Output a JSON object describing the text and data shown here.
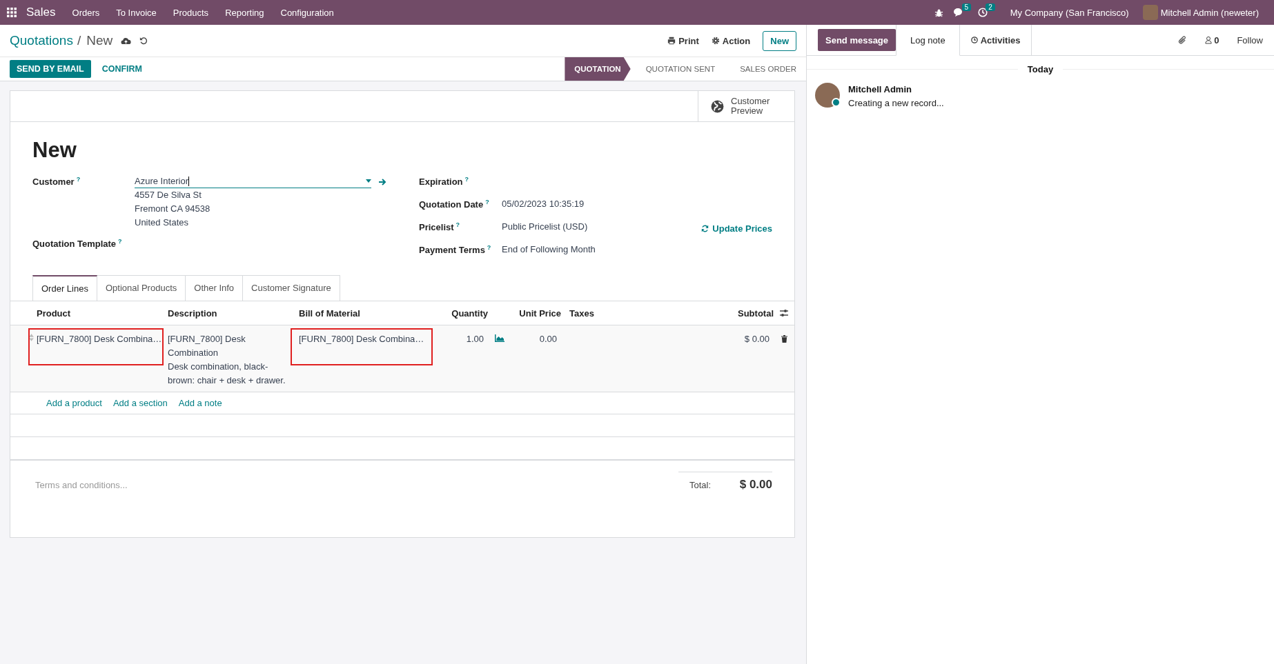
{
  "navbar": {
    "app": "Sales",
    "menu": [
      "Orders",
      "To Invoice",
      "Products",
      "Reporting",
      "Configuration"
    ],
    "messages_count": "5",
    "activities_count": "2",
    "company": "My Company (San Francisco)",
    "user": "Mitchell Admin (neweter)"
  },
  "breadcrumb": {
    "parent": "Quotations",
    "separator": "/",
    "current": "New"
  },
  "actions": {
    "print": "Print",
    "action": "Action",
    "new": "New"
  },
  "buttons": [
    {
      "label": "SEND BY EMAIL",
      "primary": true
    },
    {
      "label": "CONFIRM",
      "primary": false
    }
  ],
  "stages": [
    {
      "label": "QUOTATION",
      "selected": true
    },
    {
      "label": "QUOTATION SENT",
      "selected": false
    },
    {
      "label": "SALES ORDER",
      "selected": false
    }
  ],
  "smart_button": "Customer Preview",
  "record_title": "New",
  "left_fields": [
    {
      "label": "Customer",
      "help": "?",
      "kind": "many2one",
      "value": "Azure Interior",
      "address": [
        "4557 De Silva St",
        "Fremont CA 94538",
        "United States"
      ]
    },
    {
      "label": "Quotation Template",
      "help": "?",
      "kind": "empty"
    }
  ],
  "right_fields": [
    {
      "label": "Expiration",
      "help": "?"
    },
    {
      "label": "Quotation Date",
      "help": "?",
      "value": "05/02/2023 10:35:19"
    },
    {
      "label": "Pricelist",
      "help": "?",
      "value": "Public Pricelist (USD)",
      "action": "Update Prices"
    },
    {
      "label": "Payment Terms",
      "help": "?",
      "value": "End of Following Month"
    }
  ],
  "tabs": [
    {
      "label": "Order Lines",
      "selected": true
    },
    {
      "label": "Optional Products",
      "selected": false
    },
    {
      "label": "Other Info",
      "selected": false
    },
    {
      "label": "Customer Signature",
      "selected": false
    }
  ],
  "order_lines": {
    "columns": [
      "Product",
      "Description",
      "Bill of Material",
      "Quantity",
      "Unit Price",
      "Taxes",
      "Subtotal"
    ],
    "rows": [
      {
        "product": "[FURN_7800] Desk Combina…",
        "product_highlighted": true,
        "description": [
          "[FURN_7800] Desk Combination",
          "Desk combination, black-brown: chair + desk + drawer."
        ],
        "bom": "[FURN_7800] Desk Combina…",
        "bom_highlighted": true,
        "quantity": "1.00",
        "unit_price": "0.00",
        "subtotal": "$ 0.00"
      }
    ],
    "add_links": [
      "Add a product",
      "Add a section",
      "Add a note"
    ]
  },
  "terms_placeholder": "Terms and conditions...",
  "total_label": "Total:",
  "total": "$ 0.00",
  "chatter": {
    "send_message": "Send message",
    "log_note": "Log note",
    "activities": "Activities",
    "followers_count": "0",
    "follow": "Follow",
    "date_separator": "Today",
    "messages": [
      {
        "author": "Mitchell Admin",
        "body": "Creating a new record...",
        "online": true
      }
    ]
  }
}
